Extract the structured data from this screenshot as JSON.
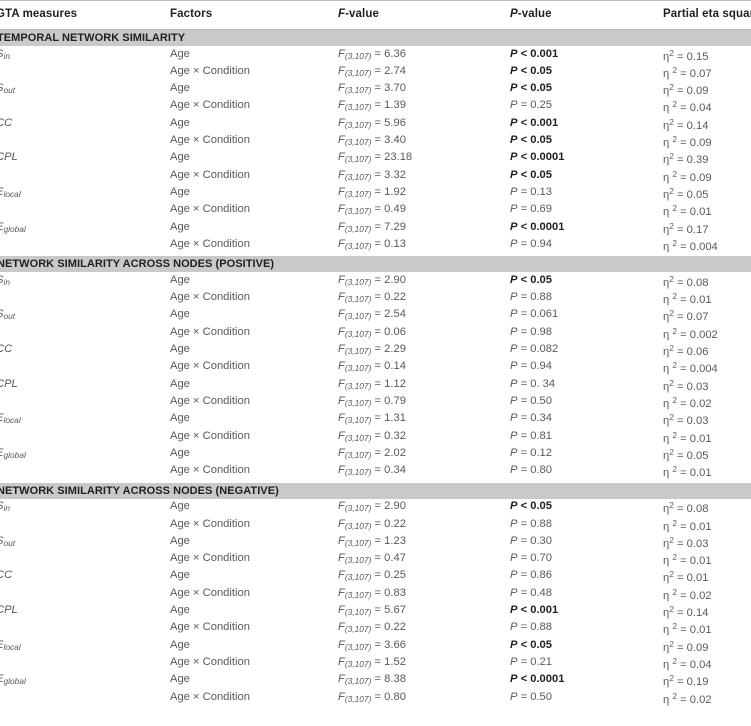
{
  "table": {
    "columns": [
      {
        "key": "measures",
        "label": "GTA measures",
        "italic_prefix": ""
      },
      {
        "key": "factors",
        "label": "Factors"
      },
      {
        "key": "fvalue",
        "label_italic": "F",
        "label_rest": "-value"
      },
      {
        "key": "pvalue",
        "label_italic": "P",
        "label_rest": "-value"
      },
      {
        "key": "eta",
        "label": "Partial eta squared"
      }
    ],
    "sections": [
      {
        "title": "TEMPORAL NETWORK SIMILARITY",
        "rows": [
          {
            "measure": "S",
            "sub": "in",
            "factor": "Age",
            "f": "6.36",
            "df": "(3,107)",
            "p": "P < 0.001",
            "sig": true,
            "eta": "0.15",
            "eta_space": false
          },
          {
            "measure": "",
            "sub": "",
            "factor": "Age × Condition",
            "f": "2.74",
            "df": "(3,107)",
            "p": "P < 0.05",
            "sig": true,
            "eta": "0.07",
            "eta_space": true
          },
          {
            "measure": "S",
            "sub": "out",
            "factor": "Age",
            "f": "3.70",
            "df": "(3,107)",
            "p": "P < 0.05",
            "sig": true,
            "eta": "0.09",
            "eta_space": false
          },
          {
            "measure": "",
            "sub": "",
            "factor": "Age × Condition",
            "f": "1.39",
            "df": "(3,107)",
            "p": "P = 0.25",
            "sig": false,
            "eta": "0.04",
            "eta_space": true
          },
          {
            "measure": "CC",
            "sub": "",
            "factor": "Age",
            "f": "5.96",
            "df": "(3,107)",
            "p": "P < 0.001",
            "sig": true,
            "eta": "0.14",
            "eta_space": false
          },
          {
            "measure": "",
            "sub": "",
            "factor": "Age × Condition",
            "f": "3.40",
            "df": "(3,107)",
            "p": "P < 0.05",
            "sig": true,
            "eta": "0.09",
            "eta_space": true
          },
          {
            "measure": "CPL",
            "sub": "",
            "factor": "Age",
            "f": "23.18",
            "df": "(3,107)",
            "p": "P < 0.0001",
            "sig": true,
            "eta": "0.39",
            "eta_space": false
          },
          {
            "measure": "",
            "sub": "",
            "factor": "Age × Condition",
            "f": "3.32",
            "df": "(3,107)",
            "p": "P < 0.05",
            "sig": true,
            "eta": "0.09",
            "eta_space": true
          },
          {
            "measure": "E",
            "sub": "local",
            "factor": "Age",
            "f": "1.92",
            "df": "(3,107)",
            "p": "P = 0.13",
            "sig": false,
            "eta": "0.05",
            "eta_space": false
          },
          {
            "measure": "",
            "sub": "",
            "factor": "Age × Condition",
            "f": "0.49",
            "df": "(3,107)",
            "p": "P = 0.69",
            "sig": false,
            "eta": "0.01",
            "eta_space": true
          },
          {
            "measure": "E",
            "sub": "global",
            "factor": "Age",
            "f": "7.29",
            "df": "(3,107)",
            "p": "P < 0.0001",
            "sig": true,
            "eta": "0.17",
            "eta_space": false
          },
          {
            "measure": "",
            "sub": "",
            "factor": "Age × Condition",
            "f": "0.13",
            "df": "(3,107)",
            "p": "P = 0.94",
            "sig": false,
            "eta": "0.004",
            "eta_space": true
          }
        ]
      },
      {
        "title": "NETWORK SIMILARITY ACROSS NODES (POSITIVE)",
        "rows": [
          {
            "measure": "S",
            "sub": "in",
            "factor": "Age",
            "f": "2.90",
            "df": "(3,107)",
            "p": "P < 0.05",
            "sig": true,
            "eta": "0.08",
            "eta_space": false
          },
          {
            "measure": "",
            "sub": "",
            "factor": "Age × Condition",
            "f": "0.22",
            "df": "(3,107)",
            "p": "P = 0.88",
            "sig": false,
            "eta": "0.01",
            "eta_space": true
          },
          {
            "measure": "S",
            "sub": "out",
            "factor": "Age",
            "f": "2.54",
            "df": "(3,107)",
            "p": "P = 0.061",
            "sig": false,
            "eta": "0.07",
            "eta_space": false
          },
          {
            "measure": "",
            "sub": "",
            "factor": "Age × Condition",
            "f": "0.06",
            "df": "(3,107)",
            "p": "P = 0.98",
            "sig": false,
            "eta": "0.002",
            "eta_space": true
          },
          {
            "measure": "CC",
            "sub": "",
            "factor": "Age",
            "f": "2.29",
            "df": "(3,107)",
            "p": "P = 0.082",
            "sig": false,
            "eta": "0.06",
            "eta_space": false
          },
          {
            "measure": "",
            "sub": "",
            "factor": "Age × Condition",
            "f": "0.14",
            "df": "(3,107)",
            "p": "P = 0.94",
            "sig": false,
            "eta": "0.004",
            "eta_space": true
          },
          {
            "measure": "CPL",
            "sub": "",
            "factor": "Age",
            "f": "1.12",
            "df": "(3,107)",
            "p": "P = 0. 34",
            "sig": false,
            "eta": "0.03",
            "eta_space": false
          },
          {
            "measure": "",
            "sub": "",
            "factor": "Age × Condition",
            "f": "0.79",
            "df": "(3,107)",
            "p": "P = 0.50",
            "sig": false,
            "eta": "0.02",
            "eta_space": true
          },
          {
            "measure": "E",
            "sub": "local",
            "factor": "Age",
            "f": "1.31",
            "df": "(3,107)",
            "p": "P = 0.34",
            "sig": false,
            "eta": "0.03",
            "eta_space": false
          },
          {
            "measure": "",
            "sub": "",
            "factor": "Age × Condition",
            "f": "0.32",
            "df": "(3,107)",
            "p": "P = 0.81",
            "sig": false,
            "eta": "0.01",
            "eta_space": true
          },
          {
            "measure": "E",
            "sub": "global",
            "factor": "Age",
            "f": "2.02",
            "df": "(3,107)",
            "p": "P = 0.12",
            "sig": false,
            "eta": "0.05",
            "eta_space": false
          },
          {
            "measure": "",
            "sub": "",
            "factor": "Age × Condition",
            "f": "0.34",
            "df": "(3,107)",
            "p": "P = 0.80",
            "sig": false,
            "eta": "0.01",
            "eta_space": true
          }
        ]
      },
      {
        "title": "NETWORK SIMILARITY ACROSS NODES (NEGATIVE)",
        "rows": [
          {
            "measure": "S",
            "sub": "in",
            "factor": "Age",
            "f": "2.90",
            "df": "(3,107)",
            "p": "P < 0.05",
            "sig": true,
            "eta": "0.08",
            "eta_space": false
          },
          {
            "measure": "",
            "sub": "",
            "factor": "Age × Condition",
            "f": "0.22",
            "df": "(3,107)",
            "p": "P = 0.88",
            "sig": false,
            "eta": "0.01",
            "eta_space": true
          },
          {
            "measure": "S",
            "sub": "out",
            "factor": "Age",
            "f": "1.23",
            "df": "(3,107)",
            "p": "P = 0.30",
            "sig": false,
            "eta": "0.03",
            "eta_space": false
          },
          {
            "measure": "",
            "sub": "",
            "factor": "Age × Condition",
            "f": "0.47",
            "df": "(3,107)",
            "p": "P = 0.70",
            "sig": false,
            "eta": "0.01",
            "eta_space": true
          },
          {
            "measure": "CC",
            "sub": "",
            "factor": "Age",
            "f": "0.25",
            "df": "(3,107)",
            "p": "P = 0.86",
            "sig": false,
            "eta": "0.01",
            "eta_space": false
          },
          {
            "measure": "",
            "sub": "",
            "factor": "Age × Condition",
            "f": "0.83",
            "df": "(3,107)",
            "p": "P = 0.48",
            "sig": false,
            "eta": "0.02",
            "eta_space": true
          },
          {
            "measure": "CPL",
            "sub": "",
            "factor": "Age",
            "f": "5.67",
            "df": "(3,107)",
            "p": "P < 0.001",
            "sig": true,
            "eta": "0.14",
            "eta_space": false
          },
          {
            "measure": "",
            "sub": "",
            "factor": "Age × Condition",
            "f": "0.22",
            "df": "(3,107)",
            "p": "P = 0.88",
            "sig": false,
            "eta": "0.01",
            "eta_space": true
          },
          {
            "measure": "E",
            "sub": "local",
            "factor": "Age",
            "f": "3.66",
            "df": "(3,107)",
            "p": "P < 0.05",
            "sig": true,
            "eta": "0.09",
            "eta_space": false
          },
          {
            "measure": "",
            "sub": "",
            "factor": "Age × Condition",
            "f": "1.52",
            "df": "(3,107)",
            "p": "P = 0.21",
            "sig": false,
            "eta": "0.04",
            "eta_space": true
          },
          {
            "measure": "E",
            "sub": "global",
            "factor": "Age",
            "f": "8.38",
            "df": "(3,107)",
            "p": "P < 0.0001",
            "sig": true,
            "eta": "0.19",
            "eta_space": false
          },
          {
            "measure": "",
            "sub": "",
            "factor": "Age × Condition",
            "f": "0.80",
            "df": "(3,107)",
            "p": "P = 0.50",
            "sig": false,
            "eta": "0.02",
            "eta_space": true
          }
        ]
      }
    ],
    "colors": {
      "band": "#c7c9ca",
      "rule": "#b9bbbd",
      "header_text": "#231f20",
      "body_text": "#58595b"
    }
  }
}
